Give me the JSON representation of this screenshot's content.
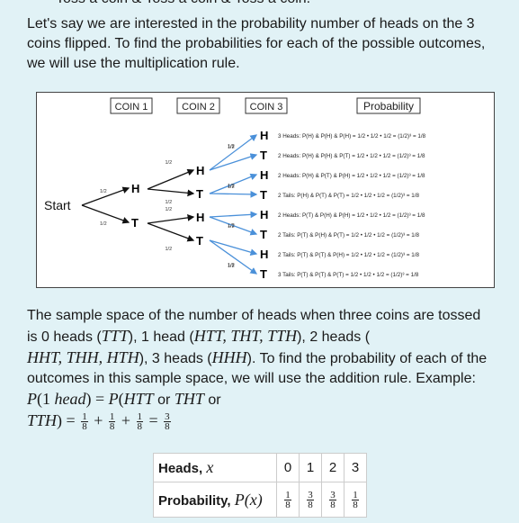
{
  "intro_cut": "Toss a coin & Toss a coin & Toss a coin.",
  "paragraph1": "Let's say we are interested in the probability number of heads on the 3 coins flipped. To find the probabilities for each of the possible outcomes, we will use the multiplication rule.",
  "figure": {
    "headers": [
      "COIN 1",
      "COIN 2",
      "COIN 3",
      "Probability"
    ],
    "start": "Start",
    "branch_label": "1/2",
    "coin1": [
      "H",
      "T"
    ],
    "coin2": [
      "H",
      "T",
      "H",
      "T"
    ],
    "coin3": [
      "H",
      "T",
      "H",
      "T",
      "H",
      "T",
      "H",
      "T"
    ],
    "probabilities": [
      "3 Heads: P(H) & P(H) & P(H) = 1/2 • 1/2 • 1/2 = (1/2)³ = 1/8",
      "2 Heads: P(H) & P(H) & P(T) = 1/2 • 1/2 • 1/2 = (1/2)³ = 1/8",
      "2 Heads: P(H) & P(T) & P(H) = 1/2 • 1/2 • 1/2 = (1/2)³ = 1/8",
      "2 Tails: P(H) & P(T) & P(T) = 1/2 • 1/2 • 1/2 = (1/2)³ = 1/8",
      "2 Heads: P(T) & P(H) & P(H) = 1/2 • 1/2 • 1/2 = (1/2)³ = 1/8",
      "2 Tails: P(T) & P(H) & P(T) = 1/2 • 1/2 • 1/2 = (1/2)³ = 1/8",
      "2 Tails: P(T) & P(T) & P(H) = 1/2 • 1/2 • 1/2 = (1/2)³ = 1/8",
      "3 Tails: P(T) & P(T) & P(T) = 1/2 • 1/2 • 1/2 = (1/2)³ = 1/8"
    ],
    "arrow_color": "#4a90d9"
  },
  "paragraph2": {
    "t1": "The sample space of the number of heads when three coins are tossed is 0 heads (",
    "m1": "TTT",
    "t2": "), 1 head (",
    "m2": "HTT, THT, TTH",
    "t3": "), 2 heads (",
    "m3": "HHT, THH, HTH",
    "t4": "), 3 heads (",
    "m4": "HHH",
    "t5": "). To find the probability of each of the outcomes in this sample space, we will use the addition rule. Example: ",
    "m5a": "P",
    "m5b": "(1 ",
    "m5c": "head",
    "m5d": ") = ",
    "m5e": "P",
    "m5f": "(",
    "m5g": "HTT",
    "or": "or",
    "m6": "THT",
    "m7": "TTH",
    "m8": ") = ",
    "plus": " + ",
    "eq": " = ",
    "one": "1",
    "three": "3",
    "eight": "8"
  },
  "table": {
    "row1_label": "Heads, ",
    "row1_var": "x",
    "row2_label": "Probability, ",
    "row2_var": "P(x)",
    "x": [
      "0",
      "1",
      "2",
      "3"
    ],
    "p_num": [
      "1",
      "3",
      "3",
      "1"
    ],
    "p_den": [
      "8",
      "8",
      "8",
      "8"
    ]
  }
}
